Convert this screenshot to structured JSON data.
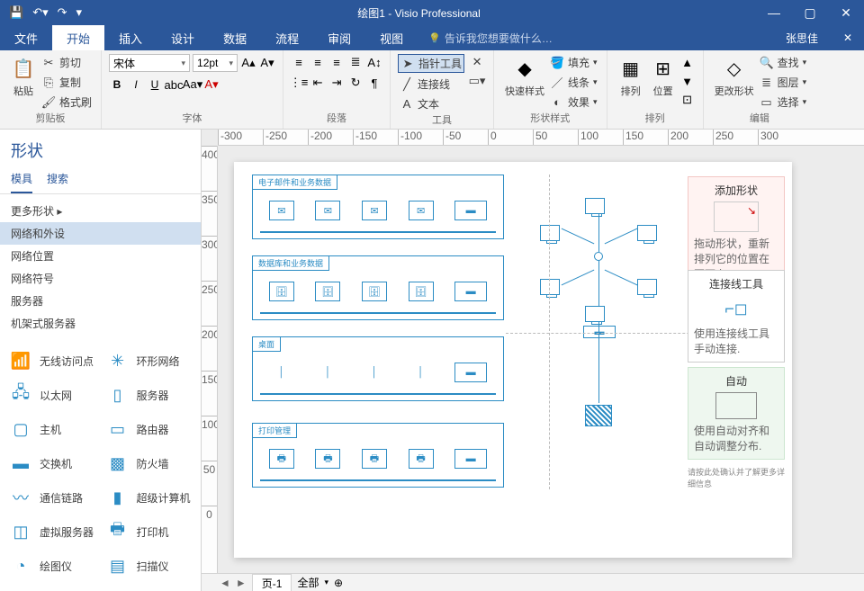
{
  "title": "绘图1 - Visio Professional",
  "qat": {
    "save_tip": "保存",
    "undo_tip": "撤销"
  },
  "win": {
    "min": "—",
    "max": "▢",
    "close": "✕"
  },
  "tabs": {
    "file": "文件",
    "home": "开始",
    "insert": "插入",
    "design": "设计",
    "data": "数据",
    "process": "流程",
    "review": "审阅",
    "view": "视图",
    "tellme": "告诉我您想要做什么…"
  },
  "user": "张思佳",
  "ribbon": {
    "clipboard": {
      "paste": "粘贴",
      "cut": "剪切",
      "copy": "复制",
      "format_painter": "格式刷",
      "label": "剪贴板"
    },
    "font": {
      "name": "宋体",
      "size": "12pt",
      "label": "字体"
    },
    "paragraph": {
      "label": "段落"
    },
    "tools": {
      "pointer": "指针工具",
      "connector": "连接线",
      "text": "文本",
      "label": "工具"
    },
    "shapestyles": {
      "quick": "快速样式",
      "fill": "填充",
      "line": "线条",
      "effects": "效果",
      "label": "形状样式"
    },
    "arrange": {
      "arrange": "排列",
      "position": "位置",
      "label": "排列"
    },
    "edit": {
      "change_shape": "更改形状",
      "find": "查找",
      "layers": "图层",
      "select": "选择",
      "label": "编辑"
    }
  },
  "ruler_h": [
    "-300",
    "-250",
    "-200",
    "-150",
    "-100",
    "-50",
    "0",
    "50",
    "100",
    "150",
    "200",
    "250",
    "300"
  ],
  "ruler_v": [
    "400",
    "350",
    "300",
    "250",
    "200",
    "150",
    "100",
    "50",
    "0"
  ],
  "shapes": {
    "title": "形状",
    "tab_stencils": "模具",
    "tab_search": "搜索",
    "more": "更多形状  ▸",
    "stencils": [
      "网络和外设",
      "网络位置",
      "网络符号",
      "服务器",
      "机架式服务器"
    ],
    "items": [
      {
        "label": "无线访问点",
        "ic": "📶"
      },
      {
        "label": "环形网络",
        "ic": "✳"
      },
      {
        "label": "以太网",
        "ic": "🖧"
      },
      {
        "label": "服务器",
        "ic": "▯"
      },
      {
        "label": "主机",
        "ic": "▢"
      },
      {
        "label": "路由器",
        "ic": "▭"
      },
      {
        "label": "交换机",
        "ic": "▬"
      },
      {
        "label": "防火墙",
        "ic": "▩"
      },
      {
        "label": "通信链路",
        "ic": "〰"
      },
      {
        "label": "超级计算机",
        "ic": "▮"
      },
      {
        "label": "虚拟服务器",
        "ic": "◫"
      },
      {
        "label": "打印机",
        "ic": "🖶"
      },
      {
        "label": "绘图仪",
        "ic": "◔"
      },
      {
        "label": "扫描仪",
        "ic": "▤"
      }
    ]
  },
  "drawing": {
    "zone1": "电子邮件和业务数据",
    "zone2": "数据库和业务数据",
    "zone3": "桌面",
    "zone4": "打印管理",
    "tip1_title": "添加形状",
    "tip1_text": "拖动形状，重新排列它的位置在页面上.",
    "tip2_title": "连接线工具",
    "tip2_text": "使用连接线工具手动连接.",
    "tip3_title": "自动",
    "tip3_text": "使用自动对齐和自动调整分布.",
    "tip4_text": "请按此处确认并了解更多详细信息"
  },
  "pagetabs": {
    "page1": "页-1",
    "all": "全部"
  }
}
